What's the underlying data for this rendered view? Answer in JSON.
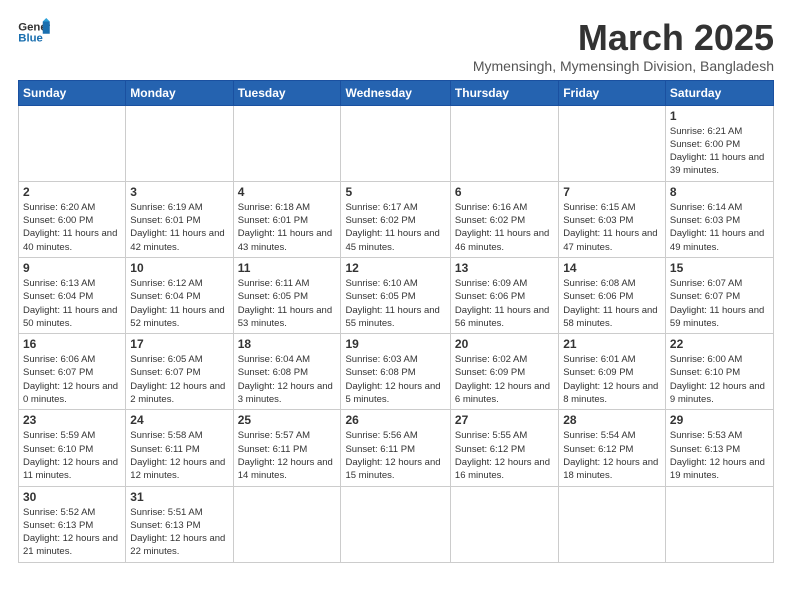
{
  "header": {
    "logo_line1": "General",
    "logo_line2": "Blue",
    "month_title": "March 2025",
    "subtitle": "Mymensingh, Mymensingh Division, Bangladesh"
  },
  "weekdays": [
    "Sunday",
    "Monday",
    "Tuesday",
    "Wednesday",
    "Thursday",
    "Friday",
    "Saturday"
  ],
  "weeks": [
    [
      {
        "day": "",
        "info": ""
      },
      {
        "day": "",
        "info": ""
      },
      {
        "day": "",
        "info": ""
      },
      {
        "day": "",
        "info": ""
      },
      {
        "day": "",
        "info": ""
      },
      {
        "day": "",
        "info": ""
      },
      {
        "day": "1",
        "info": "Sunrise: 6:21 AM\nSunset: 6:00 PM\nDaylight: 11 hours\nand 39 minutes."
      }
    ],
    [
      {
        "day": "2",
        "info": "Sunrise: 6:20 AM\nSunset: 6:00 PM\nDaylight: 11 hours\nand 40 minutes."
      },
      {
        "day": "3",
        "info": "Sunrise: 6:19 AM\nSunset: 6:01 PM\nDaylight: 11 hours\nand 42 minutes."
      },
      {
        "day": "4",
        "info": "Sunrise: 6:18 AM\nSunset: 6:01 PM\nDaylight: 11 hours\nand 43 minutes."
      },
      {
        "day": "5",
        "info": "Sunrise: 6:17 AM\nSunset: 6:02 PM\nDaylight: 11 hours\nand 45 minutes."
      },
      {
        "day": "6",
        "info": "Sunrise: 6:16 AM\nSunset: 6:02 PM\nDaylight: 11 hours\nand 46 minutes."
      },
      {
        "day": "7",
        "info": "Sunrise: 6:15 AM\nSunset: 6:03 PM\nDaylight: 11 hours\nand 47 minutes."
      },
      {
        "day": "8",
        "info": "Sunrise: 6:14 AM\nSunset: 6:03 PM\nDaylight: 11 hours\nand 49 minutes."
      }
    ],
    [
      {
        "day": "9",
        "info": "Sunrise: 6:13 AM\nSunset: 6:04 PM\nDaylight: 11 hours\nand 50 minutes."
      },
      {
        "day": "10",
        "info": "Sunrise: 6:12 AM\nSunset: 6:04 PM\nDaylight: 11 hours\nand 52 minutes."
      },
      {
        "day": "11",
        "info": "Sunrise: 6:11 AM\nSunset: 6:05 PM\nDaylight: 11 hours\nand 53 minutes."
      },
      {
        "day": "12",
        "info": "Sunrise: 6:10 AM\nSunset: 6:05 PM\nDaylight: 11 hours\nand 55 minutes."
      },
      {
        "day": "13",
        "info": "Sunrise: 6:09 AM\nSunset: 6:06 PM\nDaylight: 11 hours\nand 56 minutes."
      },
      {
        "day": "14",
        "info": "Sunrise: 6:08 AM\nSunset: 6:06 PM\nDaylight: 11 hours\nand 58 minutes."
      },
      {
        "day": "15",
        "info": "Sunrise: 6:07 AM\nSunset: 6:07 PM\nDaylight: 11 hours\nand 59 minutes."
      }
    ],
    [
      {
        "day": "16",
        "info": "Sunrise: 6:06 AM\nSunset: 6:07 PM\nDaylight: 12 hours\nand 0 minutes."
      },
      {
        "day": "17",
        "info": "Sunrise: 6:05 AM\nSunset: 6:07 PM\nDaylight: 12 hours\nand 2 minutes."
      },
      {
        "day": "18",
        "info": "Sunrise: 6:04 AM\nSunset: 6:08 PM\nDaylight: 12 hours\nand 3 minutes."
      },
      {
        "day": "19",
        "info": "Sunrise: 6:03 AM\nSunset: 6:08 PM\nDaylight: 12 hours\nand 5 minutes."
      },
      {
        "day": "20",
        "info": "Sunrise: 6:02 AM\nSunset: 6:09 PM\nDaylight: 12 hours\nand 6 minutes."
      },
      {
        "day": "21",
        "info": "Sunrise: 6:01 AM\nSunset: 6:09 PM\nDaylight: 12 hours\nand 8 minutes."
      },
      {
        "day": "22",
        "info": "Sunrise: 6:00 AM\nSunset: 6:10 PM\nDaylight: 12 hours\nand 9 minutes."
      }
    ],
    [
      {
        "day": "23",
        "info": "Sunrise: 5:59 AM\nSunset: 6:10 PM\nDaylight: 12 hours\nand 11 minutes."
      },
      {
        "day": "24",
        "info": "Sunrise: 5:58 AM\nSunset: 6:11 PM\nDaylight: 12 hours\nand 12 minutes."
      },
      {
        "day": "25",
        "info": "Sunrise: 5:57 AM\nSunset: 6:11 PM\nDaylight: 12 hours\nand 14 minutes."
      },
      {
        "day": "26",
        "info": "Sunrise: 5:56 AM\nSunset: 6:11 PM\nDaylight: 12 hours\nand 15 minutes."
      },
      {
        "day": "27",
        "info": "Sunrise: 5:55 AM\nSunset: 6:12 PM\nDaylight: 12 hours\nand 16 minutes."
      },
      {
        "day": "28",
        "info": "Sunrise: 5:54 AM\nSunset: 6:12 PM\nDaylight: 12 hours\nand 18 minutes."
      },
      {
        "day": "29",
        "info": "Sunrise: 5:53 AM\nSunset: 6:13 PM\nDaylight: 12 hours\nand 19 minutes."
      }
    ],
    [
      {
        "day": "30",
        "info": "Sunrise: 5:52 AM\nSunset: 6:13 PM\nDaylight: 12 hours\nand 21 minutes."
      },
      {
        "day": "31",
        "info": "Sunrise: 5:51 AM\nSunset: 6:13 PM\nDaylight: 12 hours\nand 22 minutes."
      },
      {
        "day": "",
        "info": ""
      },
      {
        "day": "",
        "info": ""
      },
      {
        "day": "",
        "info": ""
      },
      {
        "day": "",
        "info": ""
      },
      {
        "day": "",
        "info": ""
      }
    ]
  ]
}
